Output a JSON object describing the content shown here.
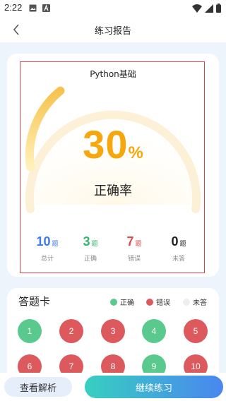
{
  "status": {
    "time": "2:22"
  },
  "header": {
    "title": "练习报告"
  },
  "report": {
    "course": "Python基础",
    "percent": "30",
    "percent_unit": "%",
    "percent_value": 30,
    "rate_label": "正确率",
    "stats": [
      {
        "value": "10",
        "unit": "题",
        "label": "总计",
        "color": "#3b7be8"
      },
      {
        "value": "3",
        "unit": "题",
        "label": "正确",
        "color": "#35b36e"
      },
      {
        "value": "7",
        "unit": "题",
        "label": "错误",
        "color": "#dc4b4b"
      },
      {
        "value": "0",
        "unit": "题",
        "label": "未答",
        "color": "#222222"
      }
    ]
  },
  "answer_card": {
    "title": "答题卡",
    "legend": [
      {
        "label": "正确",
        "color": "#5ac98e"
      },
      {
        "label": "错误",
        "color": "#dc5a5e"
      },
      {
        "label": "未答",
        "color": "#eeeeee"
      }
    ],
    "questions": [
      {
        "num": "1",
        "status": "correct"
      },
      {
        "num": "2",
        "status": "wrong"
      },
      {
        "num": "3",
        "status": "wrong"
      },
      {
        "num": "4",
        "status": "correct"
      },
      {
        "num": "5",
        "status": "wrong"
      },
      {
        "num": "6",
        "status": "wrong"
      },
      {
        "num": "7",
        "status": "wrong"
      },
      {
        "num": "8",
        "status": "wrong"
      },
      {
        "num": "9",
        "status": "correct"
      },
      {
        "num": "10",
        "status": "wrong"
      }
    ]
  },
  "footer": {
    "review_label": "查看解析",
    "continue_label": "继续练习"
  },
  "colors": {
    "accent": "#f5a70d",
    "correct": "#5ac98e",
    "wrong": "#dc5a5e",
    "primary": "#4a86f0"
  }
}
